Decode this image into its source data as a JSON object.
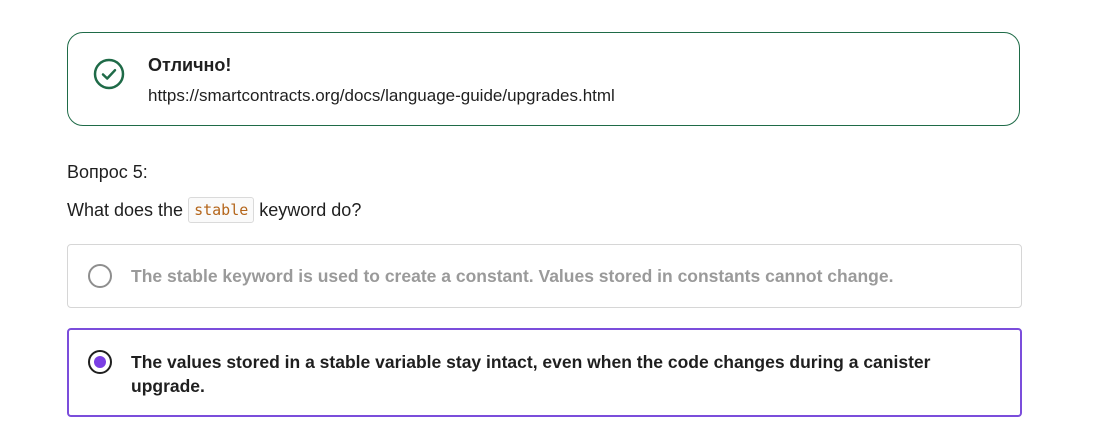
{
  "feedback": {
    "title": "Отлично!",
    "link": "https://smartcontracts.org/docs/language-guide/upgrades.html",
    "icon": "check-circle-icon",
    "color": "#1f6b48"
  },
  "question": {
    "number_label": "Вопрос 5:",
    "text_before": "What does the",
    "code": "stable",
    "text_after": "keyword do?"
  },
  "options": [
    {
      "label": "The stable keyword is used to create a constant. Values stored in constants cannot change.",
      "selected": false
    },
    {
      "label": "The values stored in a stable variable stay intact, even when the code changes during a canister upgrade.",
      "selected": true
    }
  ],
  "colors": {
    "selected_border": "#7b4ddb",
    "selected_dot": "#7b3fe4",
    "code_text": "#b4651a"
  }
}
